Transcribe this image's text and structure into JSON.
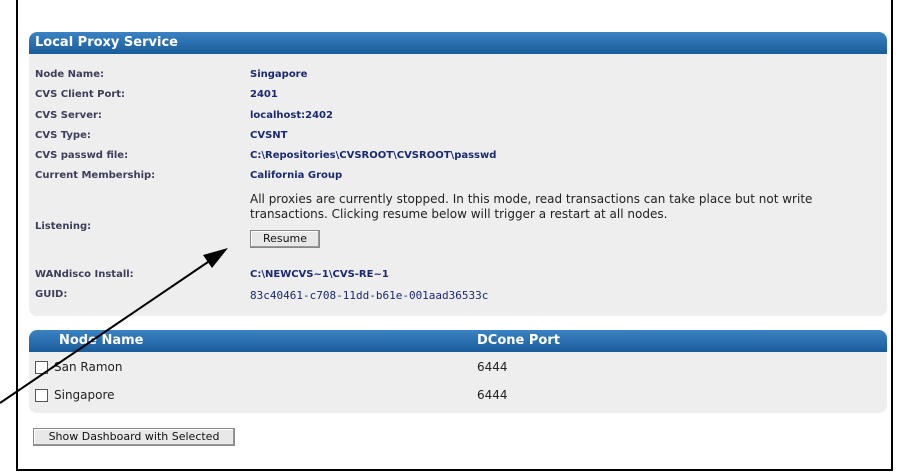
{
  "proxy": {
    "title": "Local Proxy Service",
    "fields": [
      {
        "label": "Node Name:",
        "value": "Singapore"
      },
      {
        "label": "CVS Client Port:",
        "value": "2401"
      },
      {
        "label": "CVS Server:",
        "value": "localhost:2402"
      },
      {
        "label": "CVS Type:",
        "value": "CVSNT"
      },
      {
        "label": "CVS passwd file:",
        "value": "C:\\Repositories\\CVSROOT\\CVSROOT\\passwd"
      },
      {
        "label": "Current Membership:",
        "value": "California Group"
      }
    ],
    "listening_label": "Listening:",
    "listening_text": "All proxies are currently stopped. In this mode, read transactions can take place but not write transactions. Clicking resume below will trigger a restart at all nodes.",
    "resume_label": "Resume",
    "install_label": "WANdisco Install:",
    "install_value": "C:\\NEWCVS~1\\CVS-RE~1",
    "guid_label": "GUID:",
    "guid_value": "83c40461-c708-11dd-b61e-001aad36533c"
  },
  "nodes": {
    "col_name": "Node Name",
    "col_port": "DCone Port",
    "rows": [
      {
        "name": "San Ramon",
        "port": "6444",
        "checked": false
      },
      {
        "name": "Singapore",
        "port": "6444",
        "checked": false
      }
    ]
  },
  "dashboard_button": "Show Dashboard with Selected"
}
